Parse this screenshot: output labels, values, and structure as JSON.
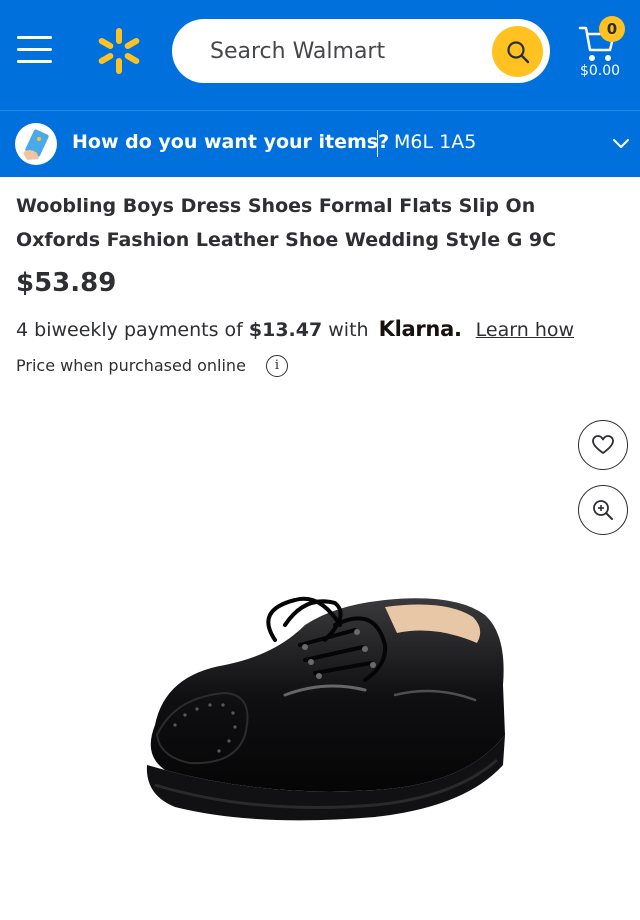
{
  "header": {
    "search_placeholder": "Search Walmart",
    "cart_count": "0",
    "cart_total": "$0.00",
    "icons": [
      "menu-icon",
      "walmart-spark-logo",
      "search-icon",
      "cart-icon"
    ],
    "colors": {
      "brand_blue": "#0071dc",
      "accent_yellow": "#ffc220"
    }
  },
  "delivery": {
    "question": "How do you want your items?",
    "postal_code": "M6L 1A5"
  },
  "product": {
    "title": "Woobling Boys Dress Shoes Formal Flats Slip On Oxfords Fashion Leather Shoe Wedding Style G 9C",
    "price": "$53.89",
    "klarna": {
      "prefix": "4 biweekly payments of",
      "amount": "$13.47",
      "with": "with",
      "brand": "Klarna.",
      "link": "Learn how"
    },
    "price_note": "Price when purchased online",
    "info_glyph": "i"
  }
}
